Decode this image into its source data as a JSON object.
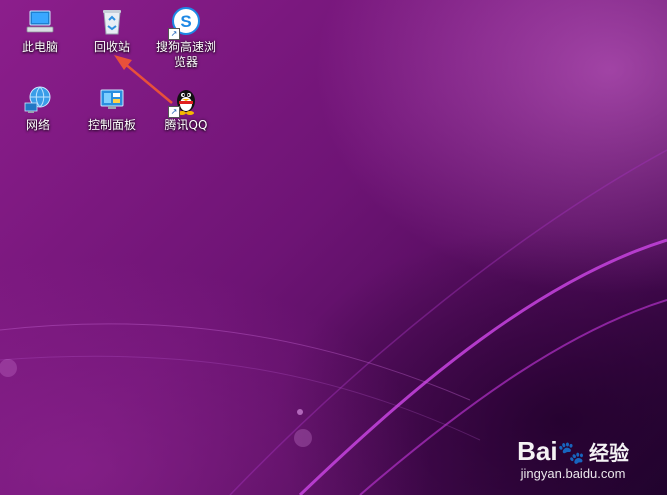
{
  "desktop": {
    "icons": [
      {
        "label": "此电脑",
        "icon": "computer-icon"
      },
      {
        "label": "回收站",
        "icon": "recycle-bin-icon"
      },
      {
        "label": "搜狗高速浏览器",
        "icon": "sogou-browser-icon"
      },
      {
        "label": "网络",
        "icon": "network-icon"
      },
      {
        "label": "控制面板",
        "icon": "control-panel-icon"
      },
      {
        "label": "腾讯QQ",
        "icon": "qq-penguin-icon"
      }
    ]
  },
  "annotation": {
    "color": "#e8503a",
    "points_to": "回收站"
  },
  "watermark": {
    "brand": "Bai",
    "brand_cn": "经验",
    "url": "jingyan.baidu.com"
  },
  "colors": {
    "wallpaper": "#6e1475",
    "accent": "#c85ad8"
  }
}
